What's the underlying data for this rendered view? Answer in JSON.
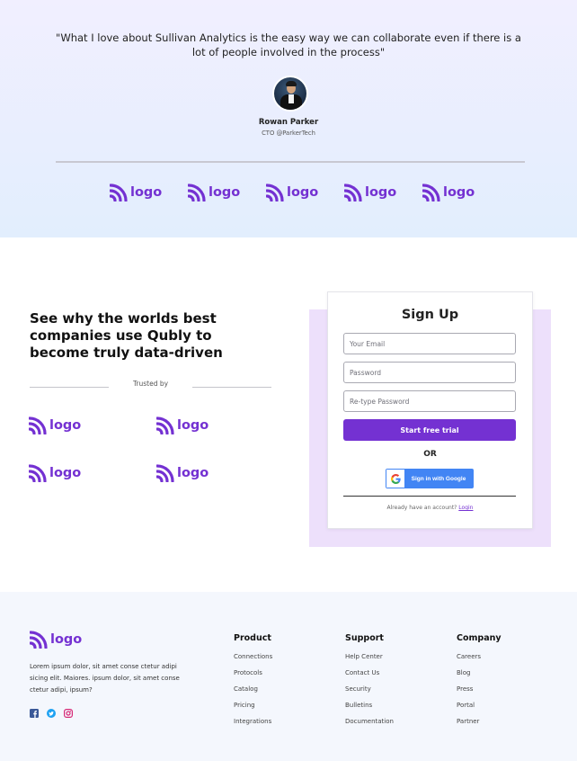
{
  "testimonial": {
    "quote": "\"What I love about Sullivan Analytics is the easy way we can collaborate even if there is a lot of people involved in the process\"",
    "name": "Rowan Parker",
    "role": "CTO @ParkerTech"
  },
  "logo_text": "logo",
  "hero": {
    "headline": "See why the worlds best companies use Qubly to become truly data-driven",
    "trusted_by": "Trusted by"
  },
  "signup": {
    "title": "Sign Up",
    "email_placeholder": "Your Email",
    "password_placeholder": "Password",
    "retype_placeholder": "Re-type Password",
    "submit_label": "Start free trial",
    "or_label": "OR",
    "google_label": "Sign in with Google",
    "have_account": "Already have an account?",
    "login_label": "Login"
  },
  "footer": {
    "description": "Lorem ipsum dolor, sit amet conse ctetur adipi sicing elit. Maiores. ipsum dolor, sit amet conse ctetur adipi, ipsum?",
    "socials": [
      "facebook-icon",
      "twitter-icon",
      "instagram-icon"
    ],
    "columns": [
      {
        "title": "Product",
        "links": [
          "Connections",
          "Protocols",
          "Catalog",
          "Pricing",
          "Integrations"
        ]
      },
      {
        "title": "Support",
        "links": [
          "Help Center",
          "Contact Us",
          "Security",
          "Bulletins",
          "Documentation"
        ]
      },
      {
        "title": "Company",
        "links": [
          "Careers",
          "Blog",
          "Press",
          "Portal",
          "Partner"
        ]
      }
    ]
  },
  "colors": {
    "brand": "#7431d2",
    "google": "#4285f4",
    "signup_backdrop": "#ede0fb",
    "footer_bg": "#f4f7fd"
  }
}
